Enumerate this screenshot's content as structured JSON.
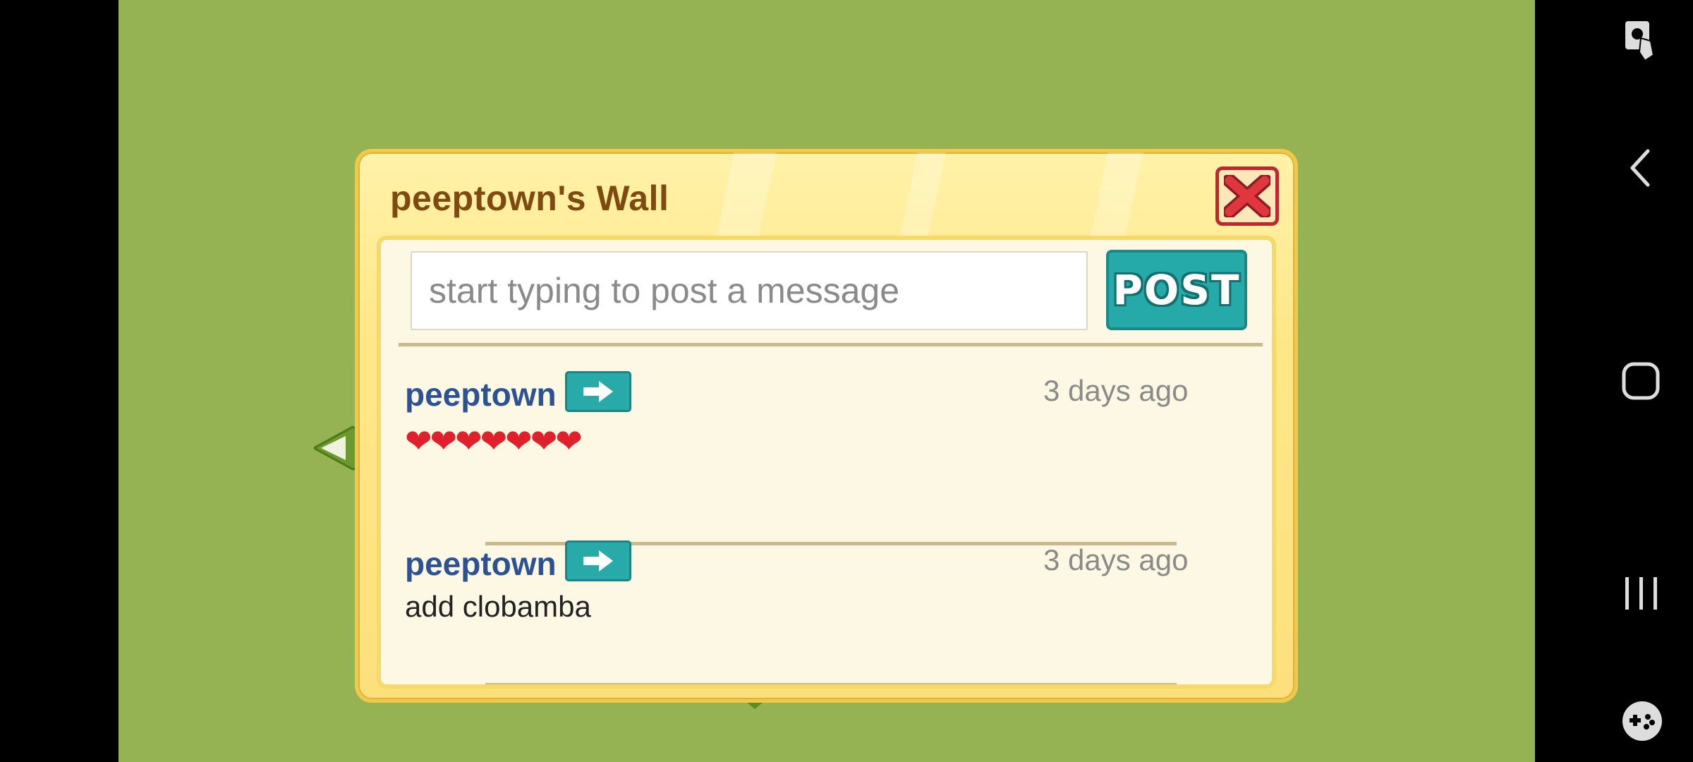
{
  "wall": {
    "title": "peeptown's Wall",
    "input_placeholder": "start typing to post a message",
    "post_label": "POST"
  },
  "posts": [
    {
      "user": "peeptown",
      "time": "3 days ago",
      "message": "❤❤❤❤❤❤❤"
    },
    {
      "user": "peeptown",
      "time": "3 days ago",
      "message": "add clobamba"
    }
  ],
  "colors": {
    "game_background": "#95b353",
    "dialog_border": "#f1c94a",
    "title_text": "#7f4a12",
    "username": "#2d5293",
    "post_button": "#25aaa9",
    "close_button": "#c0262d",
    "heart": "#e0202a"
  },
  "icons": [
    "close-x-icon",
    "arrow-right-icon",
    "screen-touch-icon",
    "back-icon",
    "home-icon",
    "recents-icon",
    "game-controller-icon"
  ]
}
